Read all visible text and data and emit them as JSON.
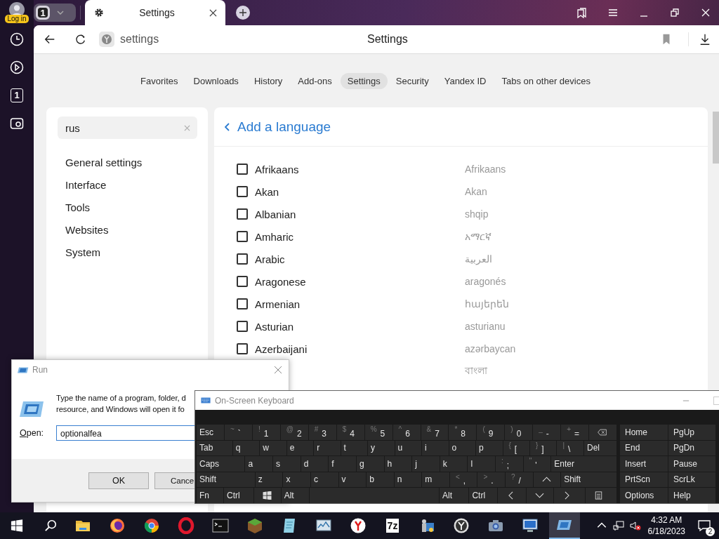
{
  "browser": {
    "profile_label": "Log in",
    "tab_counter": "1",
    "tabs": [
      {
        "title": "Settings",
        "selected": true
      }
    ],
    "address": "settings",
    "page_title": "Settings",
    "rail_counter": "1"
  },
  "nav_tabs": [
    {
      "label": "Favorites",
      "selected": false
    },
    {
      "label": "Downloads",
      "selected": false
    },
    {
      "label": "History",
      "selected": false
    },
    {
      "label": "Add-ons",
      "selected": false
    },
    {
      "label": "Settings",
      "selected": true
    },
    {
      "label": "Security",
      "selected": false
    },
    {
      "label": "Yandex ID",
      "selected": false
    },
    {
      "label": "Tabs on other devices",
      "selected": false
    }
  ],
  "sidebar": {
    "search": {
      "value": "rus"
    },
    "items": [
      {
        "label": "General settings"
      },
      {
        "label": "Interface"
      },
      {
        "label": "Tools"
      },
      {
        "label": "Websites"
      },
      {
        "label": "System"
      }
    ]
  },
  "panel": {
    "title": "Add a language",
    "languages": [
      {
        "name": "Afrikaans",
        "native": "Afrikaans",
        "checked": false
      },
      {
        "name": "Akan",
        "native": "Akan",
        "checked": false
      },
      {
        "name": "Albanian",
        "native": "shqip",
        "checked": false
      },
      {
        "name": "Amharic",
        "native": "አማርኛ",
        "checked": false
      },
      {
        "name": "Arabic",
        "native": "العربية",
        "checked": false
      },
      {
        "name": "Aragonese",
        "native": "aragonés",
        "checked": false
      },
      {
        "name": "Armenian",
        "native": "հայերեն",
        "checked": false
      },
      {
        "name": "Asturian",
        "native": "asturianu",
        "checked": false
      },
      {
        "name": "Azerbaijani",
        "native": "azərbaycan",
        "checked": false
      },
      {
        "native": "বাংলা"
      }
    ]
  },
  "run_dialog": {
    "title": "Run",
    "message_lines": [
      "Type the name of a program, folder, d",
      "resource, and Windows will open it fo"
    ],
    "open_label": "Open:",
    "value": "optionalfea",
    "buttons": [
      "OK",
      "Cance"
    ]
  },
  "keyboard": {
    "title": "On-Screen Keyboard",
    "rows": [
      {
        "keys": [
          {
            "kind": "text",
            "label": "Esc"
          },
          {
            "kind": "char",
            "shift": "~",
            "label": "`"
          },
          {
            "kind": "char",
            "shift": "!",
            "label": "1"
          },
          {
            "kind": "char",
            "shift": "@",
            "label": "2"
          },
          {
            "kind": "char",
            "shift": "#",
            "label": "3"
          },
          {
            "kind": "char",
            "shift": "$",
            "label": "4"
          },
          {
            "kind": "char",
            "shift": "%",
            "label": "5"
          },
          {
            "kind": "char",
            "shift": "^",
            "label": "6"
          },
          {
            "kind": "char",
            "shift": "&",
            "label": "7"
          },
          {
            "kind": "char",
            "shift": "*",
            "label": "8"
          },
          {
            "kind": "char",
            "shift": "(",
            "label": "9"
          },
          {
            "kind": "char",
            "shift": ")",
            "label": "0"
          },
          {
            "kind": "char",
            "shift": "_",
            "label": "-"
          },
          {
            "kind": "char",
            "shift": "+",
            "label": "="
          },
          {
            "kind": "backspace"
          }
        ]
      },
      {
        "keys": [
          {
            "kind": "text",
            "label": "Tab"
          },
          {
            "kind": "text",
            "label": "q"
          },
          {
            "kind": "text",
            "label": "w"
          },
          {
            "kind": "text",
            "label": "e"
          },
          {
            "kind": "text",
            "label": "r"
          },
          {
            "kind": "text",
            "label": "t"
          },
          {
            "kind": "text",
            "label": "y"
          },
          {
            "kind": "text",
            "label": "u"
          },
          {
            "kind": "text",
            "label": "i"
          },
          {
            "kind": "text",
            "label": "o"
          },
          {
            "kind": "text",
            "label": "p"
          },
          {
            "kind": "char",
            "shift": "{",
            "label": "["
          },
          {
            "kind": "char",
            "shift": "}",
            "label": "]"
          },
          {
            "kind": "char",
            "shift": "|",
            "label": "\\"
          },
          {
            "kind": "text",
            "label": "Del"
          }
        ]
      },
      {
        "keys": [
          {
            "kind": "text",
            "label": "Caps"
          },
          {
            "kind": "text",
            "label": "a"
          },
          {
            "kind": "text",
            "label": "s"
          },
          {
            "kind": "text",
            "label": "d"
          },
          {
            "kind": "text",
            "label": "f"
          },
          {
            "kind": "text",
            "label": "g"
          },
          {
            "kind": "text",
            "label": "h"
          },
          {
            "kind": "text",
            "label": "j"
          },
          {
            "kind": "text",
            "label": "k"
          },
          {
            "kind": "text",
            "label": "l"
          },
          {
            "kind": "char",
            "shift": ":",
            "label": ";"
          },
          {
            "kind": "char",
            "shift": "\"",
            "label": "'"
          },
          {
            "kind": "text",
            "label": "Enter"
          }
        ]
      },
      {
        "keys": [
          {
            "kind": "text",
            "label": "Shift"
          },
          {
            "kind": "text",
            "label": "z"
          },
          {
            "kind": "text",
            "label": "x"
          },
          {
            "kind": "text",
            "label": "c"
          },
          {
            "kind": "text",
            "label": "v"
          },
          {
            "kind": "text",
            "label": "b"
          },
          {
            "kind": "text",
            "label": "n"
          },
          {
            "kind": "text",
            "label": "m"
          },
          {
            "kind": "char",
            "shift": "<",
            "label": ","
          },
          {
            "kind": "char",
            "shift": ">",
            "label": "."
          },
          {
            "kind": "char",
            "shift": "?",
            "label": "/"
          },
          {
            "kind": "arrow-up"
          },
          {
            "kind": "text",
            "label": "Shift"
          }
        ]
      },
      {
        "keys": [
          {
            "kind": "text",
            "label": "Fn"
          },
          {
            "kind": "text",
            "label": "Ctrl"
          },
          {
            "kind": "windows"
          },
          {
            "kind": "text",
            "label": "Alt"
          },
          {
            "kind": "space"
          },
          {
            "kind": "text",
            "label": "Alt"
          },
          {
            "kind": "text",
            "label": "Ctrl"
          },
          {
            "kind": "arrow-left"
          },
          {
            "kind": "arrow-down"
          },
          {
            "kind": "arrow-right"
          },
          {
            "kind": "menu"
          }
        ]
      }
    ],
    "nav_keys": [
      "Home",
      "PgUp",
      "End",
      "PgDn",
      "Insert",
      "Pause",
      "PrtScn",
      "ScrLk",
      "Options",
      "Help"
    ]
  },
  "taskbar": {
    "apps": [
      {
        "kind": "folder",
        "selected": false
      },
      {
        "kind": "firefox",
        "selected": false
      },
      {
        "kind": "chrome",
        "selected": false
      },
      {
        "kind": "opera",
        "selected": false
      },
      {
        "kind": "terminal",
        "selected": false
      },
      {
        "kind": "block",
        "selected": false
      },
      {
        "kind": "notepad",
        "selected": false
      },
      {
        "kind": "monitor-chart",
        "selected": false
      },
      {
        "kind": "yandex",
        "selected": false
      },
      {
        "kind": "archiver",
        "label": "7z",
        "selected": false
      },
      {
        "kind": "run-app",
        "selected": false
      },
      {
        "kind": "clock",
        "selected": false
      },
      {
        "kind": "camera",
        "selected": false
      },
      {
        "kind": "computer",
        "selected": false
      },
      {
        "kind": "run",
        "selected": true
      }
    ],
    "time": "4:32 AM",
    "date": "6/18/2023",
    "notifications": "2"
  }
}
